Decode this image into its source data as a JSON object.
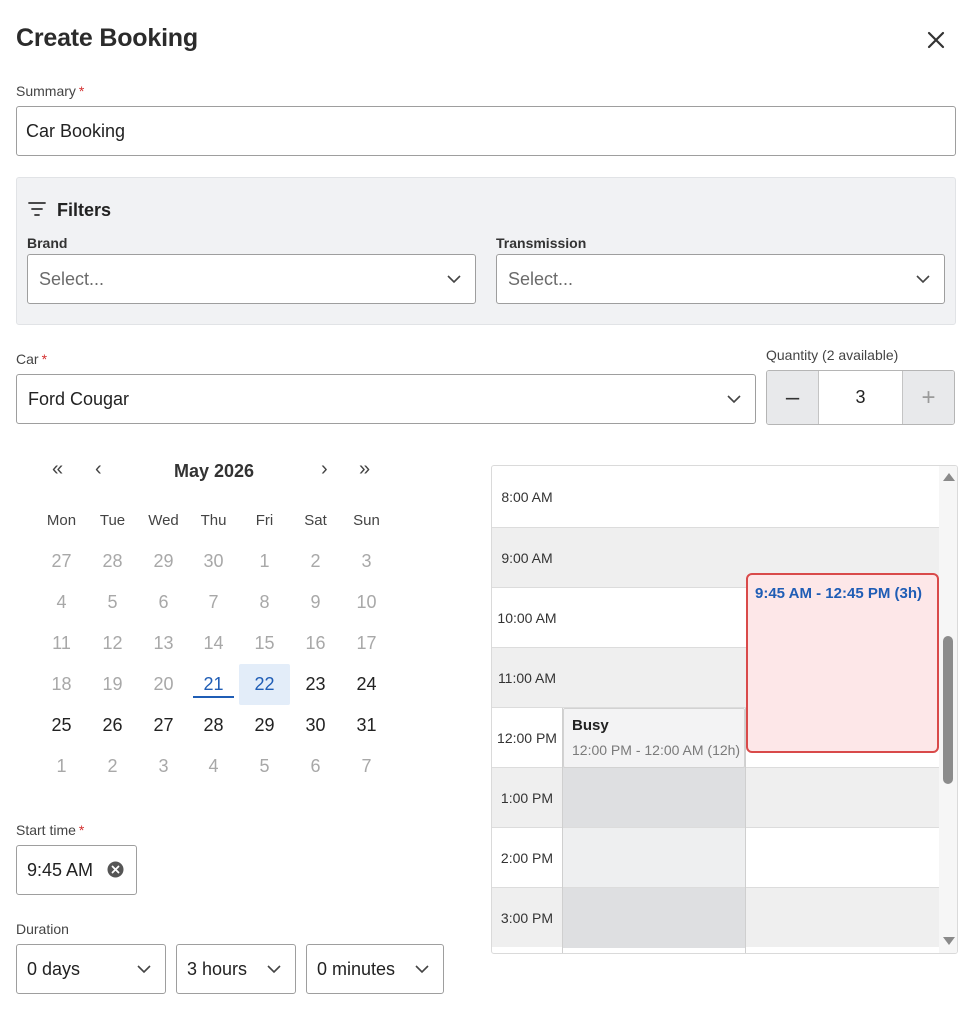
{
  "header": {
    "title": "Create Booking",
    "close_icon": "close-icon"
  },
  "summary": {
    "label": "Summary",
    "required_mark": "*",
    "value": "Car Booking"
  },
  "filters": {
    "title": "Filters",
    "icon": "filter-icon",
    "brand": {
      "label": "Brand",
      "placeholder": "Select..."
    },
    "transmission": {
      "label": "Transmission",
      "placeholder": "Select..."
    }
  },
  "car": {
    "label": "Car",
    "required_mark": "*",
    "value": "Ford Cougar"
  },
  "quantity": {
    "label": "Quantity (2 available)",
    "decrement": "–",
    "value": "3",
    "increment": "+"
  },
  "calendar": {
    "month_label": "May 2026",
    "nav": {
      "prev_year": "«",
      "prev_month": "‹",
      "next_month": "›",
      "next_year": "»"
    },
    "weekdays": [
      "Mon",
      "Tue",
      "Wed",
      "Thu",
      "Fri",
      "Sat",
      "Sun"
    ],
    "weeks": [
      [
        "27",
        "28",
        "29",
        "30",
        "1",
        "2",
        "3"
      ],
      [
        "4",
        "5",
        "6",
        "7",
        "8",
        "9",
        "10"
      ],
      [
        "11",
        "12",
        "13",
        "14",
        "15",
        "16",
        "17"
      ],
      [
        "18",
        "19",
        "20",
        "21",
        "22",
        "23",
        "24"
      ],
      [
        "25",
        "26",
        "27",
        "28",
        "29",
        "30",
        "31"
      ],
      [
        "1",
        "2",
        "3",
        "4",
        "5",
        "6",
        "7"
      ]
    ],
    "today": "21",
    "selected": "22"
  },
  "start_time": {
    "label": "Start time",
    "required_mark": "*",
    "value": "9:45 AM",
    "clear_icon": "clear-circle-icon"
  },
  "duration": {
    "label": "Duration",
    "days": "0 days",
    "hours": "3 hours",
    "minutes": "0 minutes"
  },
  "schedule": {
    "times": [
      "8:00 AM",
      "9:00 AM",
      "10:00 AM",
      "11:00 AM",
      "12:00 PM",
      "1:00 PM",
      "2:00 PM",
      "3:00 PM"
    ],
    "busy": {
      "title": "Busy",
      "range": "12:00 PM - 12:00 AM (12h)"
    },
    "booking": {
      "range": "9:45 AM - 12:45 PM (3h)"
    },
    "colors": {
      "booking_border": "#d94a4a",
      "booking_fill": "#fde7e8",
      "booking_text": "#1f5db5",
      "busy_fill": "#e0e1e3"
    }
  }
}
